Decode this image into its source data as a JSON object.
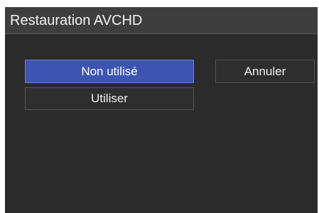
{
  "dialog": {
    "title": "Restauration AVCHD"
  },
  "options": {
    "non_utilise": "Non utilisé",
    "utiliser": "Utiliser"
  },
  "actions": {
    "cancel": "Annuler"
  },
  "colors": {
    "background": "#2b2b2b",
    "titlebar": "#3e3e3e",
    "selected_accent": "#3d55b0",
    "text": "#f0f0f0"
  }
}
